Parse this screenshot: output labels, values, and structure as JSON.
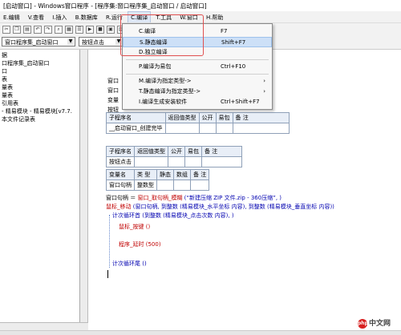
{
  "window": {
    "title": "[启动窗口] - Windows窗口程序 - [程序集:窗口程序集_启动窗口 / 启动窗口]"
  },
  "menubar": [
    "E.编辑",
    "V.查看",
    "I.插入",
    "B.数据库",
    "R.运行",
    "C.编译",
    "T.工具",
    "W.窗口",
    "H.帮助"
  ],
  "toolbar": {
    "combo_left": "窗口程序集_启动窗口",
    "combo_right": "按钮点击"
  },
  "tree": {
    "items": [
      "据",
      "口程序集_启动窗口",
      "",
      "口",
      "表",
      "量表",
      "量表",
      "引用表",
      "- 精易模块 - 精易模块[v7.7.",
      "本文件记录表"
    ]
  },
  "menu": {
    "items": [
      {
        "label": "C.编译",
        "shortcut": "F7"
      },
      {
        "label": "S.静态编译",
        "shortcut": "Shift+F7",
        "selected": true
      },
      {
        "label": "D.独立编译",
        "shortcut": ""
      },
      {
        "label": "P.编译为易包",
        "shortcut": "Ctrl+F10"
      },
      {
        "label": "M.编译为指定类型->",
        "shortcut": ""
      },
      {
        "label": "T.静态编译为指定类型->",
        "shortcut": ""
      },
      {
        "label": "I.编译生成安装软件",
        "shortcut": "Ctrl+Shift+F7"
      }
    ]
  },
  "editor": {
    "side_labels": [
      "窗口",
      "窗口",
      "变量",
      "按钮"
    ],
    "sub1": {
      "headers": [
        "子程序名",
        "返回值类型",
        "公开",
        "易包",
        "备 注"
      ],
      "row": [
        "__启动窗口_创建完毕",
        "",
        "",
        "",
        ""
      ]
    },
    "sub2": {
      "headers": [
        "子程序名",
        "返回值类型",
        "公开",
        "易包",
        "备 注"
      ],
      "row": [
        "按钮点击",
        "",
        "",
        "",
        ""
      ]
    },
    "vars": {
      "headers": [
        "变量名",
        "类 型",
        "静态",
        "数组",
        "备 注"
      ],
      "row": [
        "窗口句柄",
        "整数型",
        "",
        "",
        ""
      ]
    },
    "code": {
      "line1a": "窗口句柄 ＝ ",
      "line1b": "窗口_取句柄_模糊",
      "line1c": " (“新建压缩 ZIP 文件.zip - 360压缩”, )",
      "line2a": "鼠标_移动",
      "line2b": " (窗口句柄, 到整数 (精易模块_水平坐标 内容), 到整数 (精易模块_垂直坐标 内容))",
      "line3": "计次循环首 (到整数 (精易模块_点击次数 内容), )",
      "line4": "鼠标_按键 ()",
      "line5": "程序_延时 (500)",
      "line6": "计次循环尾 ()"
    }
  },
  "watermark": {
    "logo": "php",
    "text": "中文网"
  }
}
